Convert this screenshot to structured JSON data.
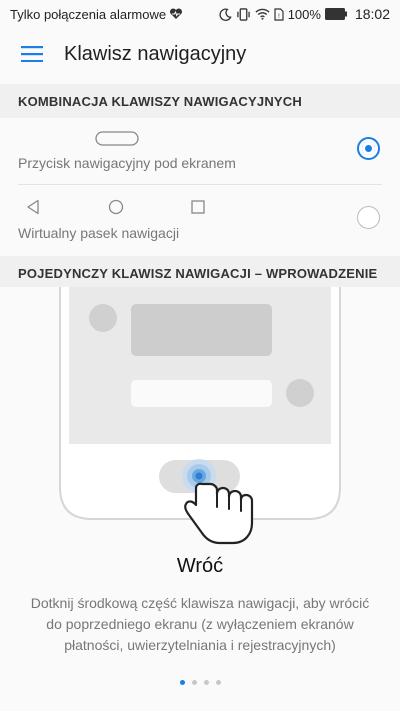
{
  "status_bar": {
    "carrier_text": "Tylko połączenia alarmowe",
    "battery_percent": "100%",
    "time": "18:02",
    "icons": [
      "heart-icon",
      "moon-icon",
      "vibrate-icon",
      "wifi-icon",
      "sim-icon",
      "battery-icon"
    ]
  },
  "app_bar": {
    "title": "Klawisz nawigacyjny",
    "menu_icon": "hamburger-icon"
  },
  "sections": {
    "combination": {
      "header": "KOMBINACJA KLAWISZY NAWIGACYJNYCH",
      "options": [
        {
          "label": "Przycisk nawigacyjny pod ekranem",
          "selected": true
        },
        {
          "label": "Wirtualny pasek nawigacji",
          "selected": false
        }
      ]
    },
    "single_key": {
      "header": "POJEDYNCZY KLAWISZ NAWIGACJI – WPROWADZENIE"
    }
  },
  "tutorial": {
    "title": "Wróć",
    "description": "Dotknij środkową część klawisza nawigacji, aby wrócić do poprzedniego ekranu (z wyłączeniem ekranów płatności, uwierzytelniania i rejestracyjnych)",
    "page_count": 4,
    "active_page": 1
  },
  "colors": {
    "accent": "#1a7ee6",
    "section_bg": "#f0f0f0",
    "background": "#fafafa"
  }
}
